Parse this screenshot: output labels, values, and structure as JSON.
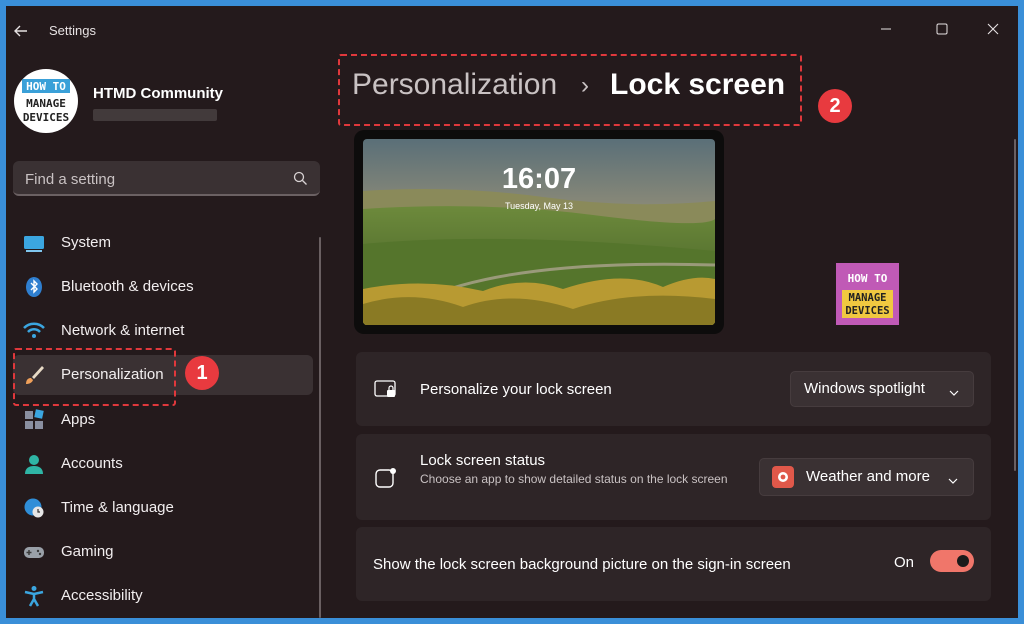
{
  "window": {
    "title": "Settings"
  },
  "profile": {
    "name": "HTMD Community"
  },
  "search": {
    "placeholder": "Find a setting"
  },
  "sidebar": {
    "items": [
      {
        "label": "System",
        "icon": "system-icon"
      },
      {
        "label": "Bluetooth & devices",
        "icon": "bluetooth-icon"
      },
      {
        "label": "Network & internet",
        "icon": "wifi-icon"
      },
      {
        "label": "Personalization",
        "icon": "brush-icon",
        "active": true
      },
      {
        "label": "Apps",
        "icon": "apps-icon"
      },
      {
        "label": "Accounts",
        "icon": "accounts-icon"
      },
      {
        "label": "Time & language",
        "icon": "globe-clock-icon"
      },
      {
        "label": "Gaming",
        "icon": "gamepad-icon"
      },
      {
        "label": "Accessibility",
        "icon": "accessibility-icon"
      }
    ]
  },
  "header": {
    "parent": "Personalization",
    "separator": "›",
    "current": "Lock screen"
  },
  "preview": {
    "time": "16:07",
    "date": "Tuesday, May 13"
  },
  "annotations": {
    "badge1": "1",
    "badge2": "2"
  },
  "logo": {
    "line1": "HOW TO",
    "line2": "MANAGE",
    "line3": "DEVICES"
  },
  "settings": {
    "personalize": {
      "title": "Personalize your lock screen",
      "value": "Windows spotlight"
    },
    "status": {
      "title": "Lock screen status",
      "description": "Choose an app to show detailed status on the lock screen",
      "value": "Weather and more"
    },
    "signin_background": {
      "title": "Show the lock screen background picture on the sign-in screen",
      "state": "On",
      "enabled": true
    }
  },
  "colors": {
    "accent": "#f0766a",
    "annotation": "#e83a3f",
    "window_bg": "#241a1c",
    "card_bg": "#2e2527"
  }
}
